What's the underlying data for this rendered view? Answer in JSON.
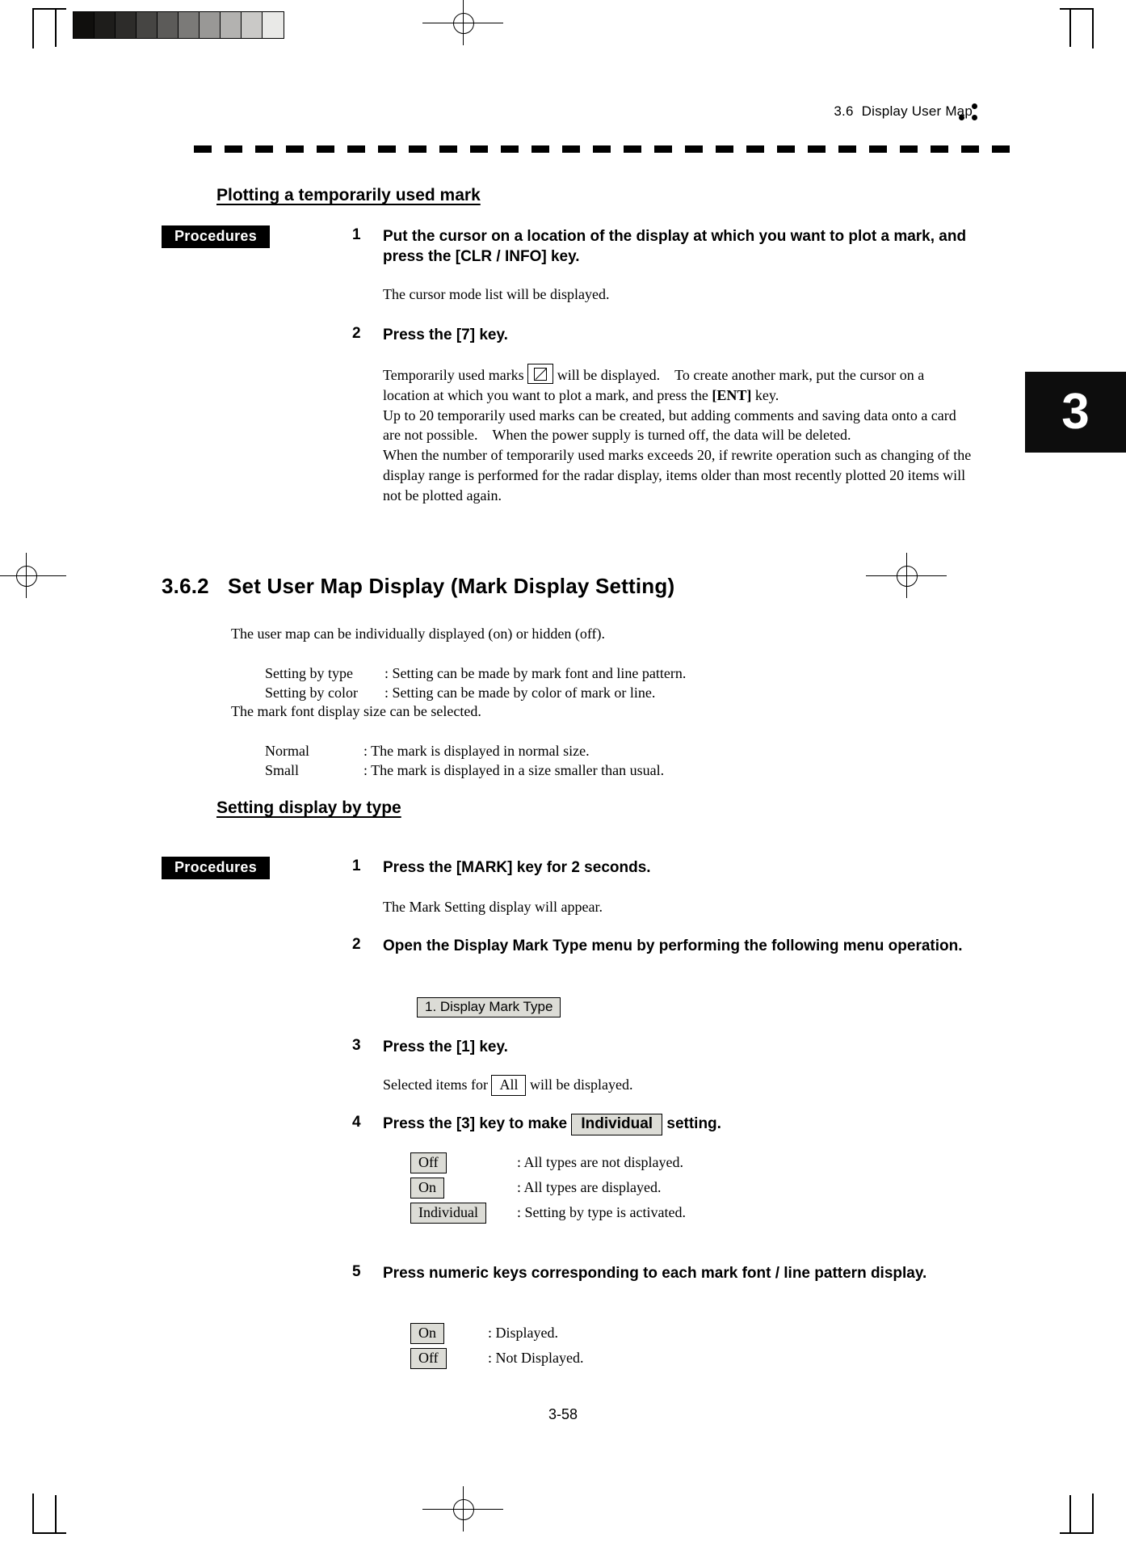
{
  "page": {
    "number": "3-58",
    "chapter_tab": "3",
    "header": {
      "section_number": "3.6",
      "section_title": "Display User Map"
    },
    "grayscale_steps": [
      "#100f0d",
      "#1e1d1b",
      "#2d2c2a",
      "#464543",
      "#5c5b59",
      "#7b7a78",
      "#999896",
      "#b3b2b0",
      "#cac9c7",
      "#e9e9e7"
    ]
  },
  "section_a": {
    "heading": "Plotting a temporarily used mark",
    "procedures_label": "Procedures",
    "steps": [
      {
        "num": "1",
        "title": "Put the cursor on a location of the display at which you want to plot a mark, and press the [CLR / INFO] key.",
        "body": "The cursor mode list will be displayed."
      },
      {
        "num": "2",
        "title": "Press the [7] key.",
        "body_parts": {
          "p1_before": "Temporarily used marks",
          "p1_after": "will be displayed. To create another mark, put the cursor on a location at which you want to plot a mark, and press the",
          "p1_bold": "[ENT]",
          "p1_tail": "key.",
          "p2": "Up to 20 temporarily used marks can be created, but adding comments and saving data onto a card are not possible. When the power supply is turned off, the data will be deleted.",
          "p3": "When the number of temporarily used marks exceeds 20, if rewrite operation such as changing of the display range is performed for the radar display, items older than most recently plotted 20 items will not be plotted again."
        }
      }
    ]
  },
  "section_b": {
    "number": "3.6.2",
    "title": "Set User Map Display (Mark Display Setting)",
    "intro": "The user map can be individually displayed (on) or hidden (off).",
    "definitions_1": [
      {
        "term": "Setting by type",
        "desc": ": Setting can be made by mark font and line pattern."
      },
      {
        "term": "Setting by color",
        "desc": ": Setting can be made by color of mark or line."
      }
    ],
    "intro_2": "The mark font display size can be selected.",
    "definitions_2": [
      {
        "term": "Normal",
        "desc": ": The mark is displayed in normal size."
      },
      {
        "term": "Small",
        "desc": ": The mark is displayed in a size smaller than usual."
      }
    ]
  },
  "section_c": {
    "heading": "Setting display by type",
    "procedures_label": "Procedures",
    "steps": [
      {
        "num": "1",
        "title": "Press the [MARK] key for 2 seconds.",
        "body": "The Mark Setting display will appear."
      },
      {
        "num": "2",
        "title": "Open the Display Mark Type menu by performing the following menu operation.",
        "menu_chip": "1. Display Mark Type"
      },
      {
        "num": "3",
        "title": "Press the [1] key.",
        "body_before": "Selected items for",
        "body_chip": "All",
        "body_after": "will be displayed."
      },
      {
        "num": "4",
        "title_before": "Press the [3] key to make",
        "title_chip": "Individual",
        "title_after": "setting.",
        "options": [
          {
            "chip": "Off",
            "desc": ": All types are not displayed."
          },
          {
            "chip": "On",
            "desc": ": All types are displayed."
          },
          {
            "chip": "Individual",
            "desc": ": Setting by type is activated."
          }
        ]
      },
      {
        "num": "5",
        "title": "Press numeric keys corresponding to each mark font / line pattern display.",
        "options": [
          {
            "chip": "On",
            "desc": ": Displayed."
          },
          {
            "chip": "Off",
            "desc": ": Not Displayed."
          }
        ]
      }
    ]
  }
}
